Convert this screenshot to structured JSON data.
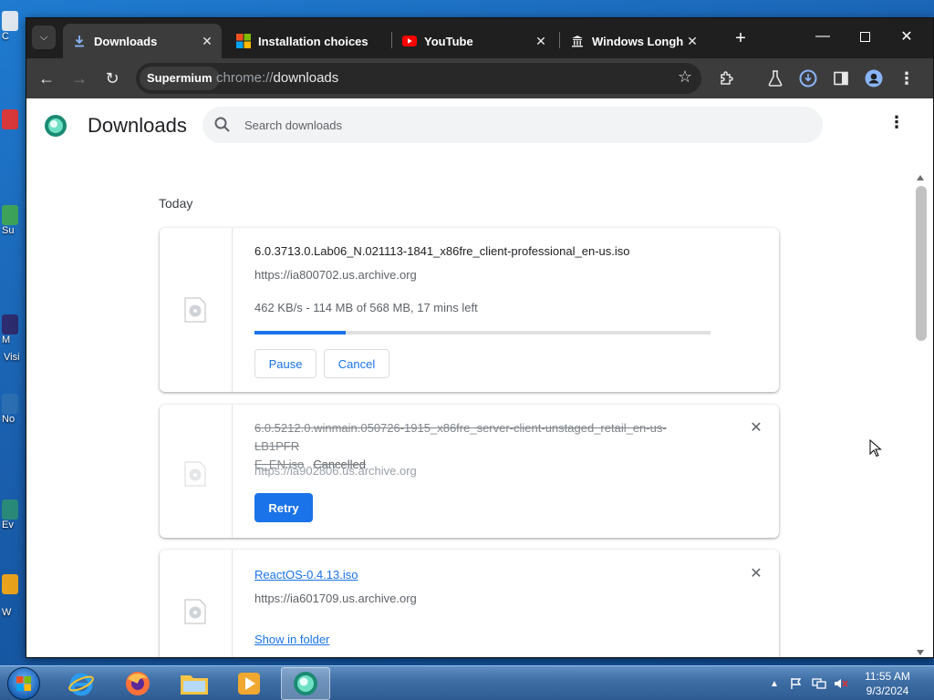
{
  "desktop": {
    "icons": [
      {
        "label": "C"
      },
      {
        "label": ""
      },
      {
        "label": "Su"
      },
      {
        "label": "M"
      },
      {
        "label": "Visi"
      },
      {
        "label": "No"
      },
      {
        "label": "Ev"
      },
      {
        "label": "W"
      }
    ]
  },
  "browser": {
    "tabs": [
      {
        "title": "Downloads",
        "icon": "download-icon",
        "active": true
      },
      {
        "title": "Installation choices",
        "icon": "windows-logo-icon",
        "active": false
      },
      {
        "title": "YouTube",
        "icon": "youtube-icon",
        "active": false
      },
      {
        "title": "Windows Longhorn",
        "icon": "archive-icon",
        "active": false
      }
    ],
    "new_tab_label": "+",
    "omnibox": {
      "chip": "Supermium",
      "url_scheme": "chrome://",
      "url_path": "downloads"
    }
  },
  "downloads": {
    "title": "Downloads",
    "search_placeholder": "Search downloads",
    "section_date": "Today",
    "items": [
      {
        "filename": "6.0.3713.0.Lab06_N.021113-1841_x86fre_client-professional_en-us.iso",
        "source": "https://ia800702.us.archive.org",
        "progress_text": "462 KB/s - 114 MB of 568 MB, 17 mins left",
        "progress_fraction": 0.2,
        "buttons": [
          "Pause",
          "Cancel"
        ]
      },
      {
        "filename_line1": "6.0.5212.0.winmain.050726-1915_x86fre_server-client-unstaged_retail_en-us-LB1PFR",
        "filename_line2": "E_EN.iso",
        "status": "Cancelled",
        "source": "https://ia902806.us.archive.org",
        "retry_label": "Retry",
        "close_label": "✕"
      },
      {
        "filename": "ReactOS-0.4.13.iso",
        "source": "https://ia601709.us.archive.org",
        "show_in_folder": "Show in folder",
        "close_label": "✕"
      }
    ]
  },
  "taskbar": {
    "apps": [
      "internet-explorer-icon",
      "firefox-icon",
      "file-explorer-icon",
      "media-player-icon",
      "supermium-icon"
    ],
    "clock_time": "11:55 AM",
    "clock_date": "9/3/2024"
  },
  "colors": {
    "accent": "#1a73e8",
    "titlebar": "#1f1f1f",
    "toolbar": "#3c3c3c"
  }
}
